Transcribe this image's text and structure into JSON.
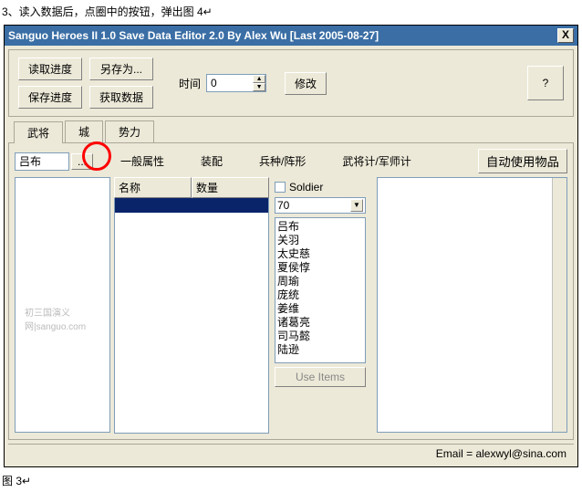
{
  "instruction": "3、读入数据后，点圈中的按钮，弹出图 4↵",
  "window": {
    "title": "Sanguo Heroes II 1.0 Save Data Editor 2.0      By Alex Wu   [Last 2005-08-27]",
    "close": "X"
  },
  "toolbar": {
    "load": "读取进度",
    "save": "保存进度",
    "saveAs": "另存为...",
    "getData": "获取数据",
    "timeLabel": "时间",
    "timeValue": "0",
    "modify": "修改",
    "help": "?"
  },
  "mainTabs": [
    "武将",
    "城",
    "势力"
  ],
  "heroName": "吕布",
  "dots": "...",
  "subTabs": [
    "一般属性",
    "装配",
    "兵种/阵形",
    "武将计/军师计"
  ],
  "autoUse": "自动使用物品",
  "gridHeaders": [
    "名称",
    "数量"
  ],
  "soldier": {
    "label": "Soldier",
    "selected": "70"
  },
  "heroList": [
    "吕布",
    "关羽",
    "太史慈",
    "夏侯惇",
    "周瑜",
    "庞统",
    "姜维",
    "诸葛亮",
    "司马懿",
    "陆逊"
  ],
  "useItems": "Use Items",
  "watermark": "初三国演义网|sanguo.com",
  "statusbar": "Email = alexwyl@sina.com",
  "caption": "图 3↵"
}
